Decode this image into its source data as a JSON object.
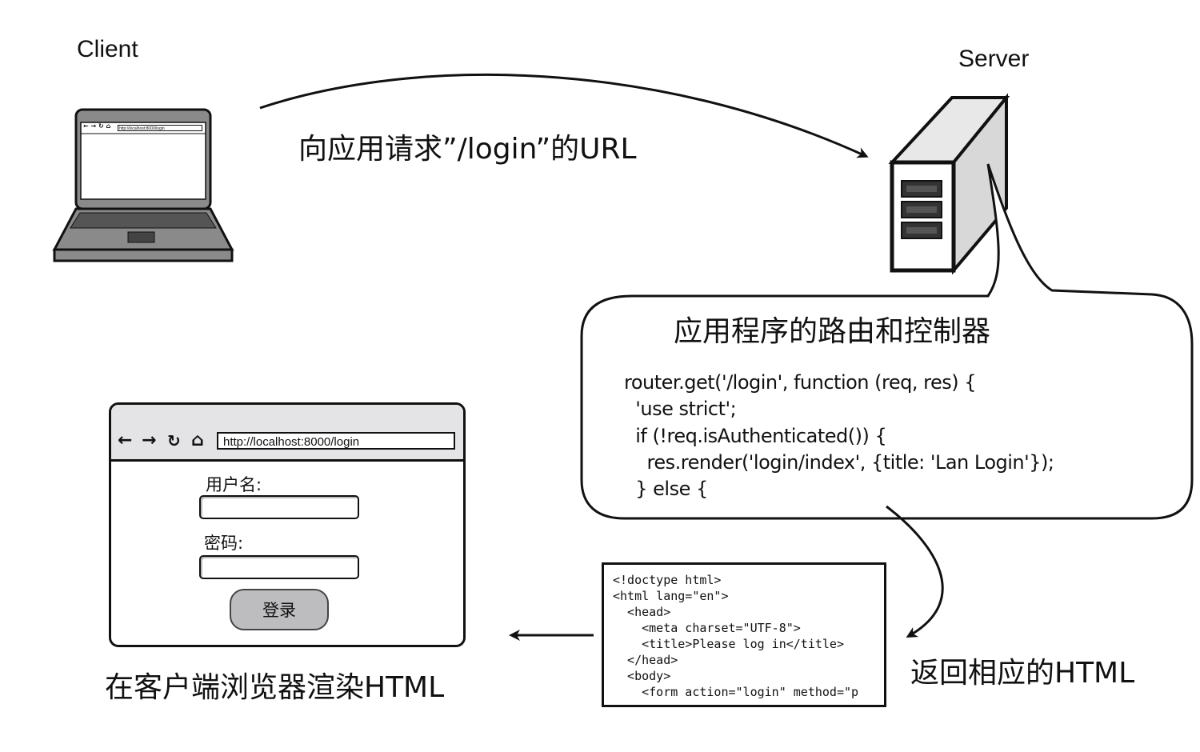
{
  "labels": {
    "client": "Client",
    "server": "Server",
    "request": "向应用请求”/login”的URL",
    "controller_title": "应用程序的路由和控制器",
    "return_html": "返回相应的HTML",
    "render_html": "在客户端浏览器渲染HTML"
  },
  "controller_code": [
    "router.get('/login', function (req, res) {",
    "  'use strict';",
    "  if (!req.isAuthenticated()) {",
    "    res.render('login/index', {title: 'Lan Login'});",
    "  } else {"
  ],
  "html_code": [
    "<!doctype html>",
    "<html lang=\"en\">",
    "  <head>",
    "    <meta charset=\"UTF-8\">",
    "    <title>Please log in</title>",
    "  </head>",
    "  <body>",
    "    <form action=\"login\" method=\"p"
  ],
  "laptop_browser": {
    "url": "http://localhost:8000/login"
  },
  "browser": {
    "url": "http://localhost:8000/login",
    "back_icon": "arrow-left-icon",
    "forward_icon": "arrow-right-icon",
    "reload_icon": "reload-icon",
    "home_icon": "home-icon",
    "username_label": "用户名:",
    "password_label": "密码:",
    "login_button": "登录"
  },
  "colors": {
    "stroke": "#111111",
    "laptop_body": "#8a8a8a",
    "laptop_keyboard": "#555555",
    "server_side": "#d8d8d8",
    "browser_bar": "#e4e4e6",
    "button_fill": "#bdbdbf"
  }
}
